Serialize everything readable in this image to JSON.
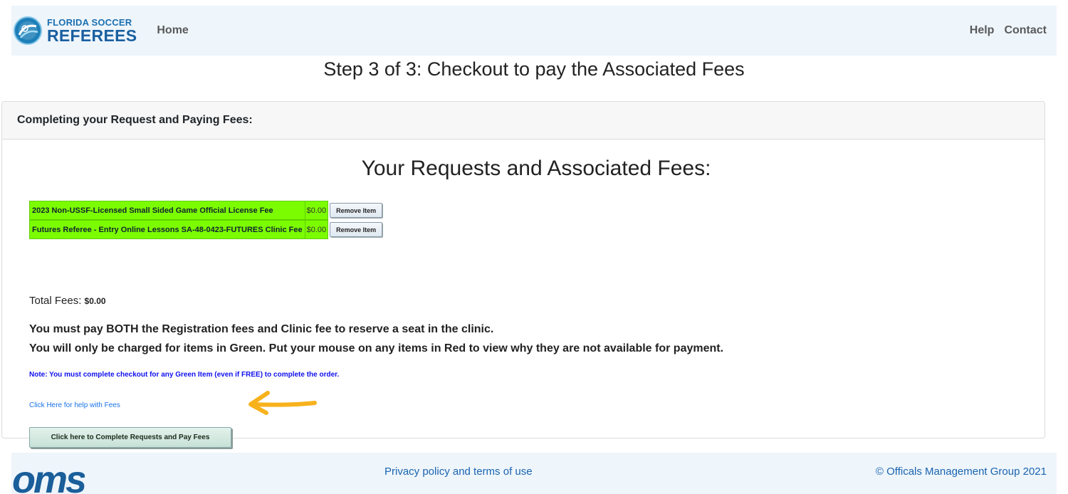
{
  "nav": {
    "brand_line1": "FLORIDA SOCCER",
    "brand_line2": "REFEREES",
    "home": "Home",
    "help": "Help",
    "contact": "Contact"
  },
  "page": {
    "step_title": "Step 3 of 3: Checkout to pay the Associated Fees"
  },
  "card": {
    "header": "Completing your Request and Paying Fees:",
    "requests_title": "Your Requests and Associated Fees:",
    "fee_items": [
      {
        "name": "2023 Non-USSF-Licensed Small Sided Game Official License Fee",
        "price": "$0.00",
        "remove_label": "Remove Item",
        "status": "green"
      },
      {
        "name": "Futures Referee - Entry Online Lessons SA-48-0423-FUTURES Clinic Fee",
        "price": "$0.00",
        "remove_label": "Remove Item",
        "status": "green"
      }
    ],
    "total_label": "Total Fees:",
    "total_value": "$0.00",
    "notice_line1": "You must pay BOTH the Registration fees and Clinic fee to reserve a seat in the clinic.",
    "notice_line2": "You will only be charged for items in Green. Put your mouse on any items in Red to view why they are not available for payment.",
    "note": "Note: You must complete checkout for any Green Item (even if FREE) to complete the order.",
    "help_link": "Click Here for help with Fees",
    "pay_button": "Click here to Complete Requests and Pay Fees"
  },
  "footer": {
    "logo": "oms",
    "privacy": "Privacy policy and terms of use",
    "copyright": "© Officals Management Group 2021"
  },
  "colors": {
    "green_item": "#7cfc00",
    "nav_bg": "#eef5fb",
    "note_blue": "#1010ee",
    "link_blue": "#1a73e8",
    "annotation_arrow": "#f7b21c"
  },
  "icons": {
    "brand_logo": "referee-whistle-badge-icon",
    "annotation": "arrow-left-icon"
  }
}
